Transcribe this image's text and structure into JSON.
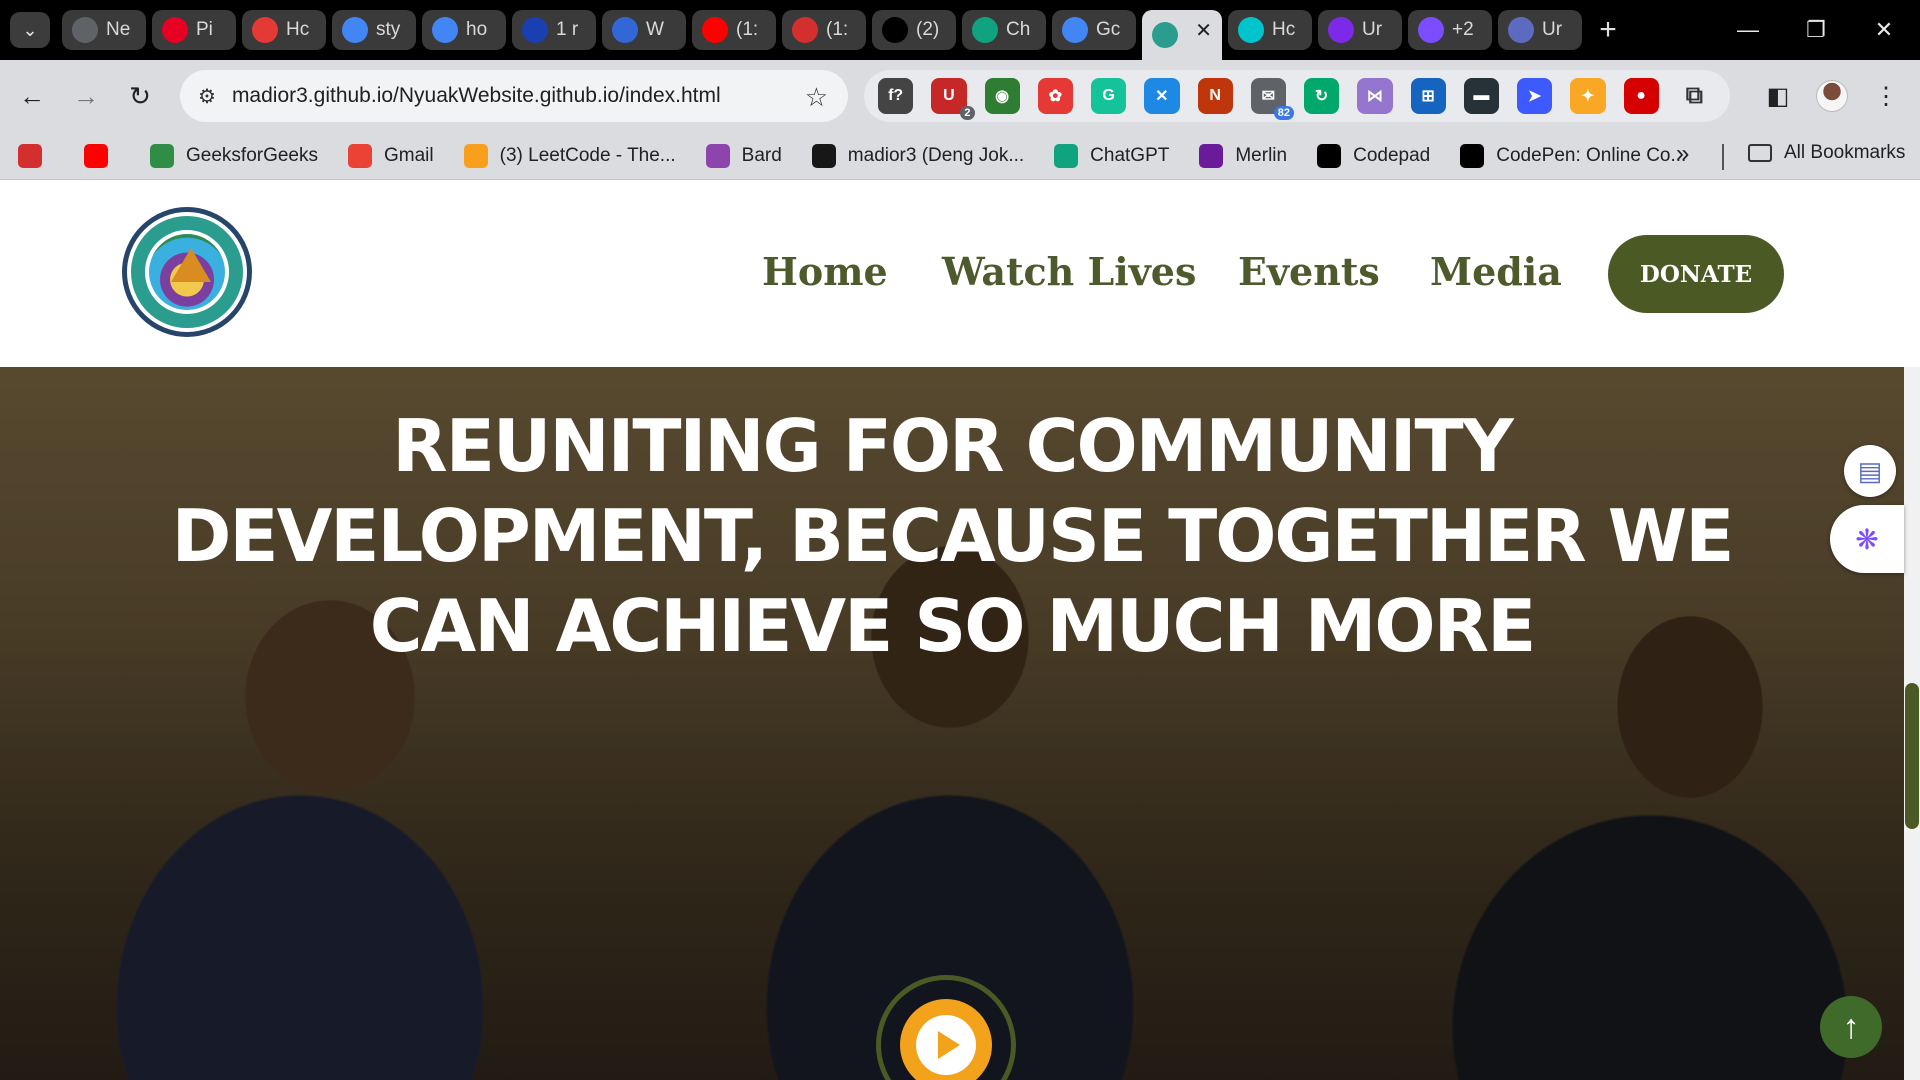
{
  "browser": {
    "tabs": [
      {
        "label": "Ne",
        "icon": "chrome-icon",
        "color": "#5f6368"
      },
      {
        "label": "Pi",
        "icon": "pinterest-icon",
        "color": "#e60023"
      },
      {
        "label": "Hc",
        "icon": "n-icon",
        "color": "#e53935"
      },
      {
        "label": "sty",
        "icon": "google-icon",
        "color": "#4285f4"
      },
      {
        "label": "ho",
        "icon": "google-icon",
        "color": "#4285f4"
      },
      {
        "label": "1 r",
        "icon": "k-icon",
        "color": "#1a3fb0"
      },
      {
        "label": "W",
        "icon": "g-icon",
        "color": "#3367d6"
      },
      {
        "label": "(1:",
        "icon": "youtube-icon",
        "color": "#ff0000"
      },
      {
        "label": "(1:",
        "icon": "record-icon",
        "color": "#d32f2f"
      },
      {
        "label": "(2)",
        "icon": "x-icon",
        "color": "#000000"
      },
      {
        "label": "Ch",
        "icon": "chatgpt-icon",
        "color": "#10a37f"
      },
      {
        "label": "Gc",
        "icon": "google-icon",
        "color": "#4285f4"
      },
      {
        "label": "",
        "icon": "site-icon",
        "color": "#2a9d8f",
        "active": true
      },
      {
        "label": "Hc",
        "icon": "canva-icon",
        "color": "#00c4cc"
      },
      {
        "label": "Ur",
        "icon": "canva-icon",
        "color": "#7d2ae8"
      },
      {
        "label": "+2",
        "icon": "heart-icon",
        "color": "#7c4dff"
      },
      {
        "label": "Ur",
        "icon": "app-icon",
        "color": "#5c6bc0"
      }
    ],
    "url": "madior3.github.io/NyuakWebsite.github.io/index.html",
    "extensions": [
      {
        "glyph": "f?",
        "color": "#444444"
      },
      {
        "glyph": "U",
        "color": "#c62828",
        "badge": "2"
      },
      {
        "glyph": "◉",
        "color": "#2e7d32"
      },
      {
        "glyph": "✿",
        "color": "#e53935"
      },
      {
        "glyph": "G",
        "color": "#15c39a"
      },
      {
        "glyph": "✕",
        "color": "#1e88e5"
      },
      {
        "glyph": "N",
        "color": "#bf360c"
      },
      {
        "glyph": "✉",
        "color": "#5f6368",
        "badge": "82"
      },
      {
        "glyph": "↻",
        "color": "#00a86b"
      },
      {
        "glyph": "⋈",
        "color": "#9575cd"
      },
      {
        "glyph": "⊞",
        "color": "#1565c0"
      },
      {
        "glyph": "▬",
        "color": "#263238"
      },
      {
        "glyph": "➤",
        "color": "#3d5afe"
      },
      {
        "glyph": "✦",
        "color": "#f9a825"
      },
      {
        "glyph": "●",
        "color": "#d50000"
      }
    ],
    "bookmarks": [
      {
        "label": "",
        "icon": "speed-icon",
        "color": "#d32f2f"
      },
      {
        "label": "",
        "icon": "youtube-icon",
        "color": "#ff0000"
      },
      {
        "label": "GeeksforGeeks",
        "icon": "gfg-icon",
        "color": "#2f8d46"
      },
      {
        "label": "Gmail",
        "icon": "gmail-icon",
        "color": "#ea4335"
      },
      {
        "label": "(3) LeetCode - The...",
        "icon": "leetcode-icon",
        "color": "#f89f1b"
      },
      {
        "label": "Bard",
        "icon": "bard-icon",
        "color": "#8e44ad"
      },
      {
        "label": "madior3 (Deng Jok...",
        "icon": "github-icon",
        "color": "#181717"
      },
      {
        "label": "ChatGPT",
        "icon": "chatgpt-icon",
        "color": "#10a37f"
      },
      {
        "label": "Merlin",
        "icon": "merlin-icon",
        "color": "#6a1b9a"
      },
      {
        "label": "Codepad",
        "icon": "codepad-icon",
        "color": "#000000"
      },
      {
        "label": "CodePen: Online Co...",
        "icon": "codepen-icon",
        "color": "#000000"
      }
    ],
    "all_bookmarks": "All Bookmarks"
  },
  "site": {
    "logo_alt": "Nyuak Community Development",
    "nav": [
      "Home",
      "Watch Lives",
      "Events",
      "Media"
    ],
    "donate": "DONATE",
    "hero_title": "REUNITING FOR COMMUNITY DEVELOPMENT, BECAUSE TOGETHER WE CAN ACHIEVE SO MUCH MORE",
    "colors": {
      "primary": "#4b5a25",
      "accent": "#f3a21c",
      "scroll_top": "#3f6a2a"
    }
  }
}
